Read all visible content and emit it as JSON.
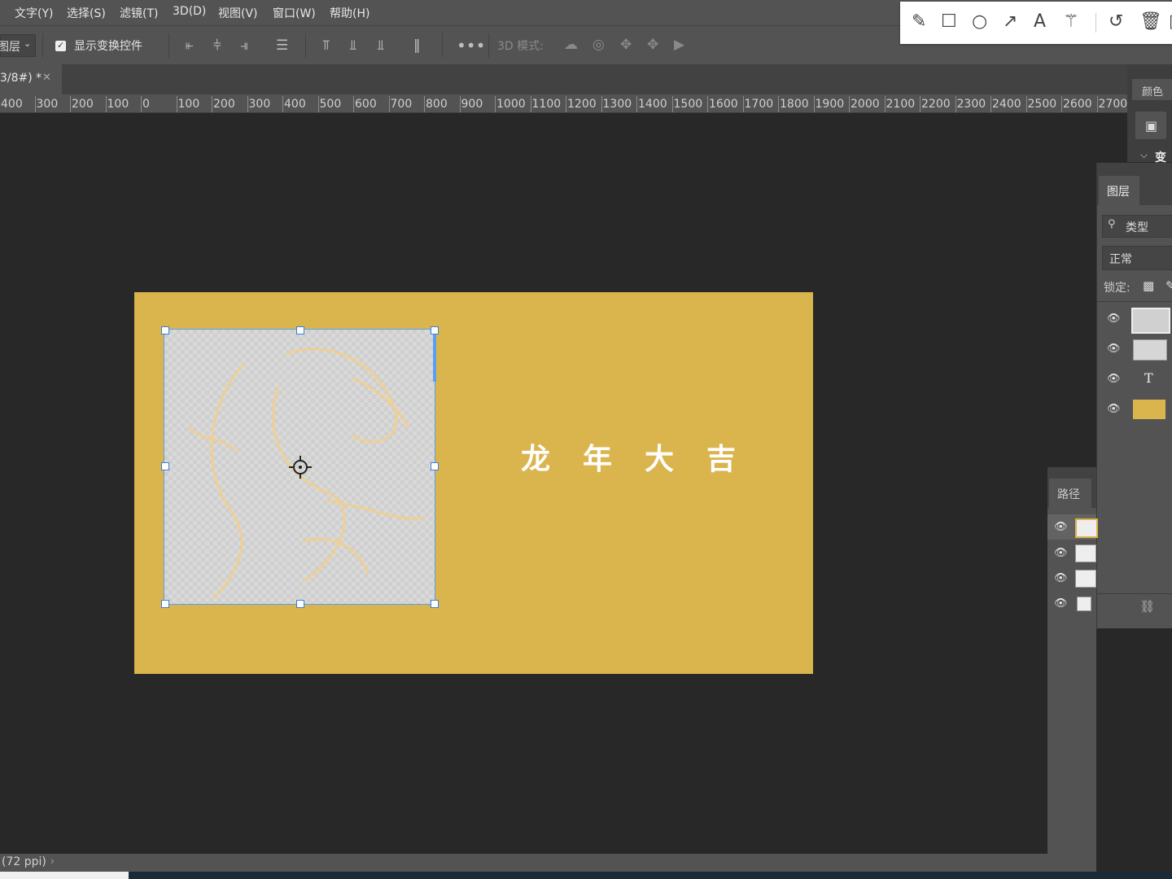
{
  "menu": {
    "items": [
      "文字(Y)",
      "选择(S)",
      "滤镜(T)",
      "3D(D)",
      "视图(V)",
      "窗口(W)",
      "帮助(H)"
    ]
  },
  "options": {
    "layer_dropdown": "图层",
    "show_transform_label": "显示变换控件",
    "show_transform_checked": true,
    "mode_3d_label": "3D 模式:"
  },
  "annotation_tools": [
    "pencil-icon",
    "rectangle-icon",
    "circle-icon",
    "arrow-icon",
    "text-icon",
    "magic-wand-icon",
    "undo-icon",
    "trash-icon"
  ],
  "document": {
    "tab_label": "3/8#) *",
    "ruler_labels": [
      "400",
      "300",
      "200",
      "100",
      "0",
      "100",
      "200",
      "300",
      "400",
      "500",
      "600",
      "700",
      "800",
      "900",
      "1000",
      "1100",
      "1200",
      "1300",
      "1400",
      "1500",
      "1600",
      "1700",
      "1800",
      "1900",
      "2000",
      "2100",
      "2200",
      "2300",
      "2400",
      "2500",
      "2600",
      "2700"
    ],
    "canvas_text": "龙年大吉",
    "artboard_color": "#dab44d"
  },
  "panels": {
    "color_tab": "颜色",
    "transform_tab": "变",
    "layers_tab": "图层",
    "search_label": "类型",
    "blend_mode": "正常",
    "lock_label": "锁定:",
    "paths_tab": "路径"
  },
  "status": {
    "resolution": "(72 ppi)"
  }
}
